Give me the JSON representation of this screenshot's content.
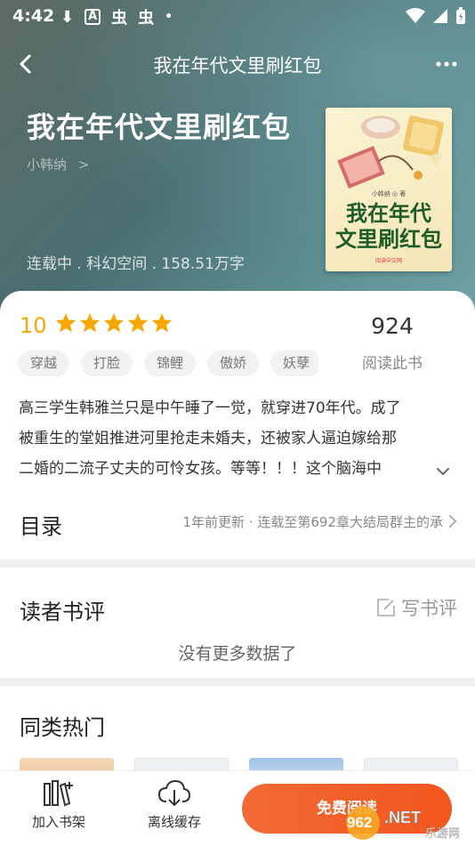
{
  "status_bar": {
    "time": "4:42",
    "left_glyphs": [
      "⬇",
      "A",
      "虫",
      "虫",
      "•"
    ]
  },
  "topbar": {
    "title": "我在年代文里刷红包"
  },
  "book": {
    "title": "我在年代文里刷红包",
    "author": "小韩纳",
    "author_chevron": ">",
    "meta": "连载中 . 科幻空间 . 158.51万字",
    "cover": {
      "author_line": "小韩纳 ◎ 著",
      "title_line1": "我在年代",
      "title_line2": "文里刷红包",
      "publisher": "阅读中文网"
    }
  },
  "rating": {
    "score": "10",
    "stars": 5,
    "star_color": "#f6a800"
  },
  "readers": {
    "count": "924",
    "label": "阅读此书"
  },
  "tags": [
    "穿越",
    "打脸",
    "锦鲤",
    "傲娇",
    "妖孽"
  ],
  "description": {
    "line1": "高三学生韩雅兰只是中午睡了一觉，就穿进70年代。成了",
    "line2": "被重生的堂姐推进河里抢走未婚夫，还被家人逼迫嫁给那",
    "line3": "二婚的二流子丈夫的可怜女孩。等等！！！这个脑海中"
  },
  "toc": {
    "label": "目录",
    "info": "1年前更新 · 连载至第692章大结局群主的承"
  },
  "reviews": {
    "title": "读者书评",
    "write_label": "写书评",
    "empty_text": "没有更多数据了"
  },
  "similar": {
    "title": "同类热门"
  },
  "bottom_bar": {
    "add_shelf": "加入书架",
    "offline_cache": "离线缓存",
    "read_free": "免费阅读"
  },
  "watermark": {
    "text": "962.NET",
    "subtext": "乐游网"
  },
  "colors": {
    "accent_orange": "#f3561f",
    "star_yellow": "#f6a800",
    "hero_teal": "#4a6f72"
  }
}
